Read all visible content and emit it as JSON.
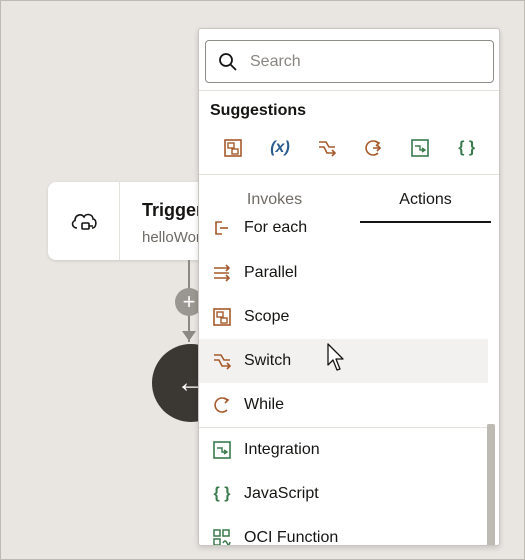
{
  "canvas": {
    "trigger": {
      "title": "Trigger",
      "subtitle": "helloWorld"
    }
  },
  "panel": {
    "search": {
      "placeholder": "Search",
      "value": ""
    },
    "suggestions": {
      "title": "Suggestions",
      "icons": [
        {
          "name": "scope-icon",
          "glyph": "",
          "color": "#a65a2c"
        },
        {
          "name": "variable-icon",
          "glyph": "(x)",
          "color": "#2b5d8e"
        },
        {
          "name": "switch-icon",
          "glyph": "",
          "color": "#a65a2c"
        },
        {
          "name": "while-icon",
          "glyph": "",
          "color": "#a65a2c"
        },
        {
          "name": "integration-icon",
          "glyph": "",
          "color": "#3a7a4c"
        },
        {
          "name": "javascript-icon",
          "glyph": "{ }",
          "color": "#3a7a4c"
        }
      ]
    },
    "tabs": {
      "invokes": "Invokes",
      "actions": "Actions"
    },
    "items": [
      {
        "label": "For each"
      },
      {
        "label": "Parallel"
      },
      {
        "label": "Scope"
      },
      {
        "label": "Switch"
      },
      {
        "label": "While"
      },
      {
        "label": "Integration"
      },
      {
        "label": "JavaScript"
      },
      {
        "label": "OCI Function"
      }
    ]
  },
  "colors": {
    "action": "#a65a2c",
    "integration": "#3a7a4c",
    "variable": "#2b5d8e"
  }
}
